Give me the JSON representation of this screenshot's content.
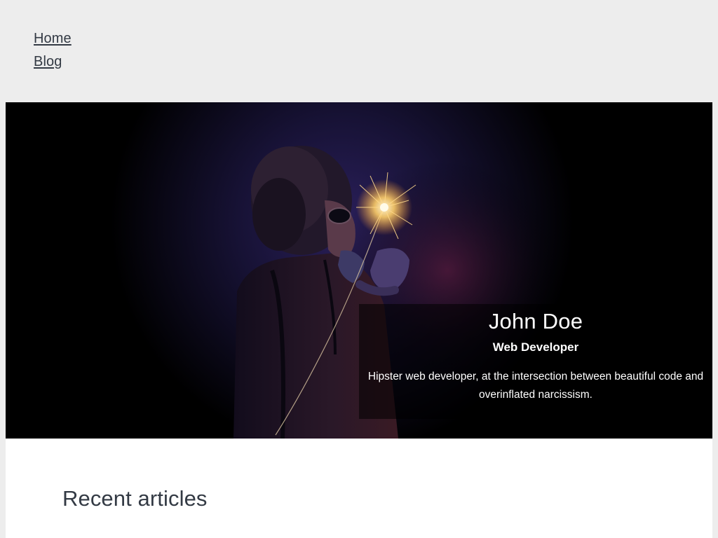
{
  "nav": {
    "items": [
      {
        "label": "Home"
      },
      {
        "label": "Blog"
      }
    ]
  },
  "hero": {
    "name": "John Doe",
    "role": "Web Developer",
    "bio": "Hipster web developer, at the intersection between beautiful code and overinflated narcissism."
  },
  "main": {
    "section_title": "Recent articles"
  },
  "colors": {
    "page_background": "#ededed",
    "text": "#333a44",
    "hero_background": "#000000",
    "caption_text": "#ffffff",
    "panel_background": "#ffffff"
  }
}
